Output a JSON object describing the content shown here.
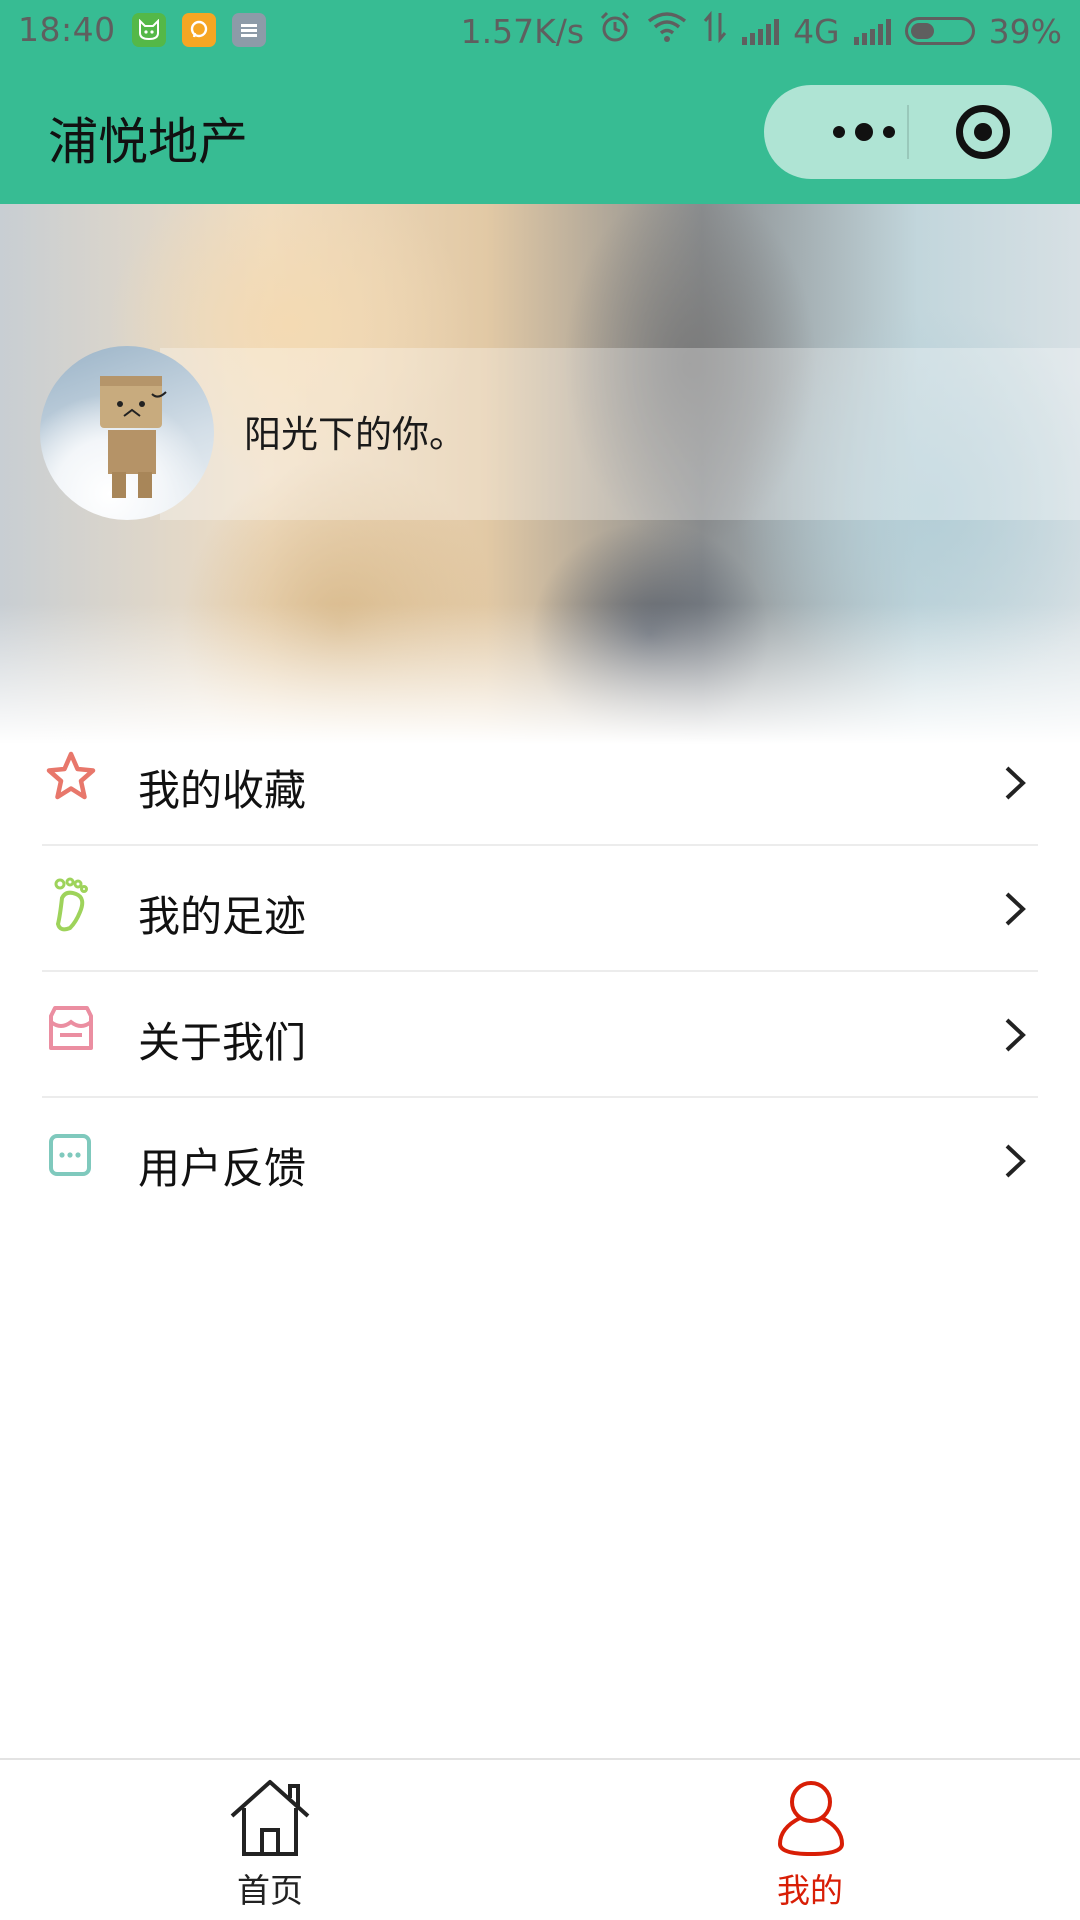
{
  "status_bar": {
    "time": "18:40",
    "network_speed": "1.57K/s",
    "network_type": "4G",
    "battery_percent": "39%",
    "battery_level": 0.39,
    "icons": [
      "cat-app-icon",
      "chat-app-icon",
      "list-app-icon",
      "alarm-icon",
      "wifi-icon",
      "data-transfer-icon",
      "signal-icon",
      "signal-icon-2",
      "battery-icon"
    ]
  },
  "nav": {
    "title": "浦悦地产",
    "background": "#37bc93",
    "more_icon": "more-dots-icon",
    "close_icon": "target-circle-icon"
  },
  "profile": {
    "username": "阳光下的你。",
    "avatar": "danbo-avatar"
  },
  "menu": {
    "items": [
      {
        "label": "我的收藏",
        "icon": "star-icon",
        "color": "#e8776b"
      },
      {
        "label": "我的足迹",
        "icon": "footprint-icon",
        "color": "#9ed35b"
      },
      {
        "label": "关于我们",
        "icon": "store-icon",
        "color": "#eb8ea1"
      },
      {
        "label": "用户反馈",
        "icon": "feedback-icon",
        "color": "#7fc9bd"
      }
    ],
    "chevron_icon": "chevron-right-icon"
  },
  "tabbar": {
    "tabs": [
      {
        "label": "首页",
        "icon": "home-icon",
        "active": false
      },
      {
        "label": "我的",
        "icon": "user-icon",
        "active": true
      }
    ],
    "active_color": "#d81e06",
    "inactive_color": "#222222"
  }
}
